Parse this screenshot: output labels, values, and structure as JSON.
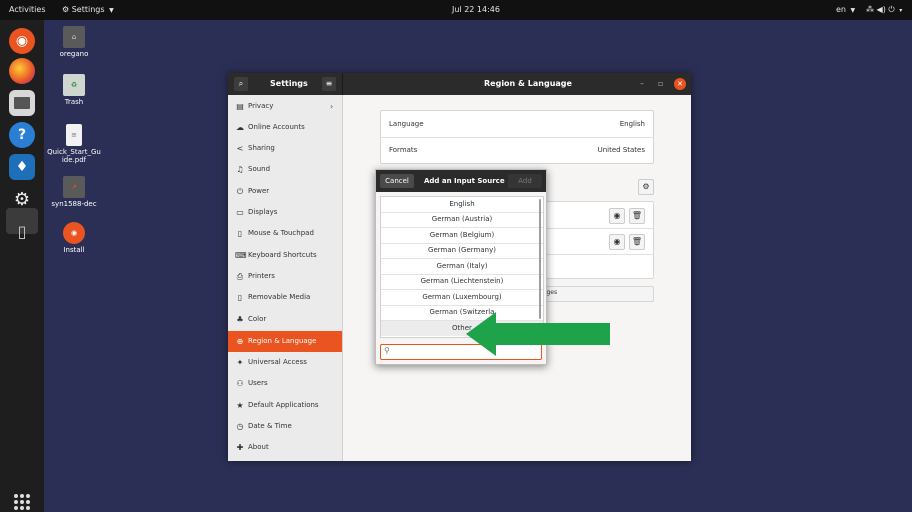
{
  "topbar": {
    "activities": "Activities",
    "app_menu": "Settings",
    "clock": "Jul 22  14:46",
    "language": "en",
    "power_caret": "▾"
  },
  "desktop": {
    "icons": [
      {
        "label": "oregano"
      },
      {
        "label": "Trash"
      },
      {
        "label": "Quick_Start_Guide.pdf"
      },
      {
        "label": "syn1588-dec"
      },
      {
        "label": "Install"
      }
    ]
  },
  "window": {
    "sidebar_title": "Settings",
    "panel_title": "Region & Language",
    "sidebar": [
      {
        "label": "Privacy",
        "icon": "privacy-icon"
      },
      {
        "label": "Online Accounts",
        "icon": "cloud-icon"
      },
      {
        "label": "Sharing",
        "icon": "share-icon"
      },
      {
        "label": "Sound",
        "icon": "music-note-icon"
      },
      {
        "label": "Power",
        "icon": "power-icon"
      },
      {
        "label": "Displays",
        "icon": "display-icon"
      },
      {
        "label": "Mouse & Touchpad",
        "icon": "mouse-icon"
      },
      {
        "label": "Keyboard Shortcuts",
        "icon": "keyboard-icon"
      },
      {
        "label": "Printers",
        "icon": "printer-icon"
      },
      {
        "label": "Removable Media",
        "icon": "usb-icon"
      },
      {
        "label": "Color",
        "icon": "palette-icon"
      },
      {
        "label": "Region & Language",
        "icon": "globe-icon"
      },
      {
        "label": "Universal Access",
        "icon": "accessibility-icon"
      },
      {
        "label": "Users",
        "icon": "users-icon"
      },
      {
        "label": "Default Applications",
        "icon": "star-icon"
      },
      {
        "label": "Date & Time",
        "icon": "clock-icon"
      },
      {
        "label": "About",
        "icon": "info-icon"
      }
    ],
    "language_label": "Language",
    "language_value": "English",
    "formats_label": "Formats",
    "formats_value": "United States",
    "manage_fragment": "uages"
  },
  "dialog": {
    "cancel": "Cancel",
    "title": "Add an Input Source",
    "add": "Add",
    "items": [
      "English",
      "German (Austria)",
      "German (Belgium)",
      "German (Germany)",
      "German (Italy)",
      "German (Liechtenstein)",
      "German (Luxembourg)",
      "German (Switzerla",
      "Other"
    ],
    "search_placeholder": ""
  },
  "colors": {
    "accent": "#e95420",
    "arrow": "#1fa34a",
    "desktop_bg": "#2c2f55"
  }
}
